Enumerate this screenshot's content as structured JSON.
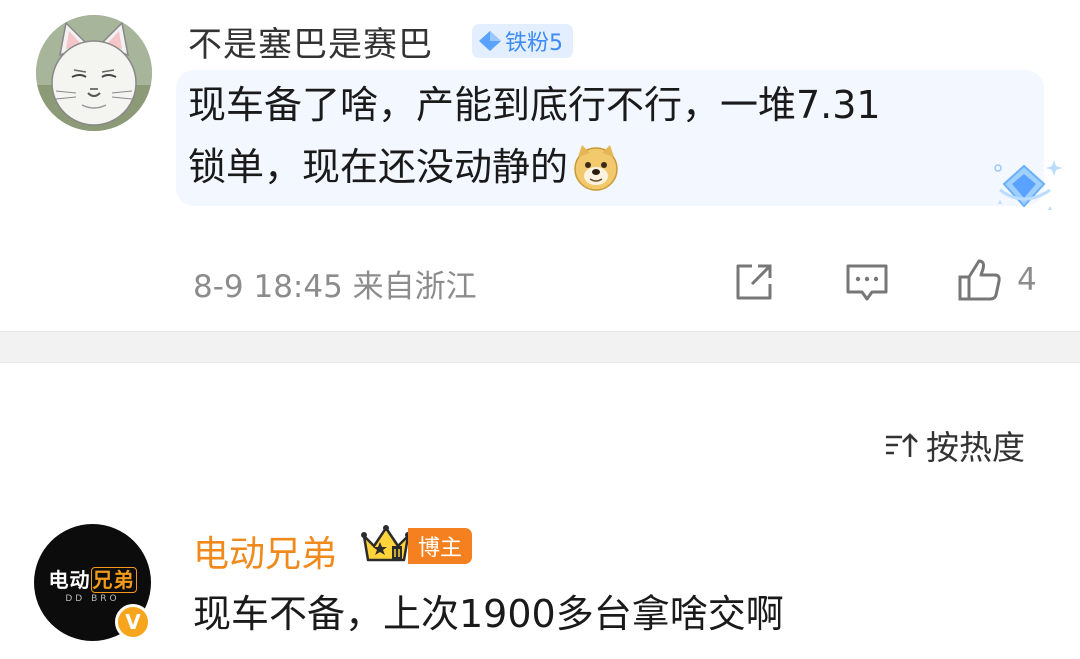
{
  "post1": {
    "username": "不是塞巴是赛巴",
    "badge_label": "铁粉5",
    "content_line1": "现车备了啥，产能到底行不行，一堆7.31",
    "content_line2": "锁单，现在还没动静的",
    "emoji": "doge-emoji",
    "meta": "8-9 18:45 来自浙江",
    "like_count": "4"
  },
  "sort": {
    "label": "按热度"
  },
  "post2": {
    "username": "电动兄弟",
    "badge_label": "博主",
    "avatar_logo_a": "电动",
    "avatar_logo_b": "兄弟",
    "avatar_sub": "DD BRO",
    "verified_label": "V",
    "content": "现车不备，上次1900多台拿啥交啊"
  },
  "colors": {
    "bubble_bg": "#f3f7ff",
    "badge_blue": "#3d8bf5",
    "username_orange": "#f08a1c",
    "blogger_badge": "#f5801f",
    "meta_gray": "#8c8c8c"
  }
}
